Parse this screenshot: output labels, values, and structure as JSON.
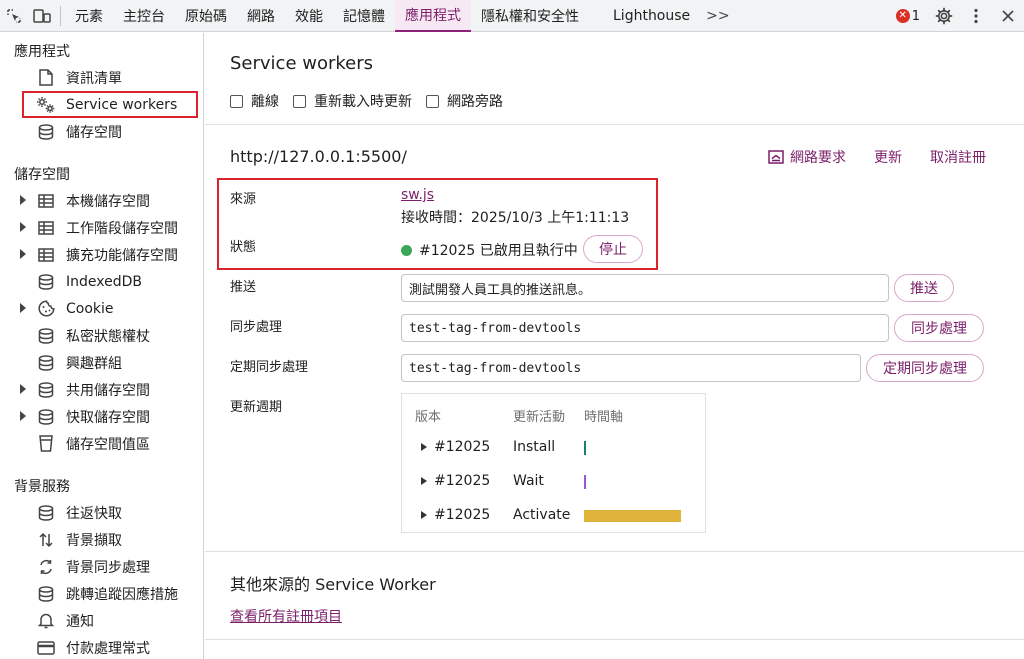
{
  "tabs": {
    "items": [
      "元素",
      "主控台",
      "原始碼",
      "網路",
      "效能",
      "記憶體",
      "應用程式",
      "隱私權和安全性",
      "Lighthouse"
    ],
    "more": ">>",
    "error_count": "1"
  },
  "sidebar": {
    "app_section": "應用程式",
    "app_items": [
      "資訊清單",
      "Service workers",
      "儲存空間"
    ],
    "storage_section": "儲存空間",
    "storage_items": [
      "本機儲存空間",
      "工作階段儲存空間",
      "擴充功能儲存空間",
      "IndexedDB",
      "Cookie",
      "私密狀態權杖",
      "興趣群組",
      "共用儲存空間",
      "快取儲存空間",
      "儲存空間值區"
    ],
    "bg_section": "背景服務",
    "bg_items": [
      "往返快取",
      "背景擷取",
      "背景同步處理",
      "跳轉追蹤因應措施",
      "通知",
      "付款處理常式"
    ]
  },
  "main": {
    "title": "Service workers",
    "options": [
      "離線",
      "重新載入時更新",
      "網路旁路"
    ],
    "origin": "http://127.0.0.1:5500/",
    "actions": {
      "network_requests": "網路要求",
      "update": "更新",
      "unregister": "取消註冊"
    },
    "source_label": "來源",
    "source_file": "sw.js",
    "received": "接收時間：2025/10/3 上午1:11:13",
    "status_label": "狀態",
    "status_text": "#12025 已啟用且執行中",
    "stop_label": "停止",
    "push_label": "推送",
    "push_value": "測試開發人員工具的推送訊息。",
    "push_button": "推送",
    "sync_label": "同步處理",
    "sync_value": "test-tag-from-devtools",
    "sync_button": "同步處理",
    "periodic_label": "定期同步處理",
    "periodic_value": "test-tag-from-devtools",
    "periodic_button": "定期同步處理",
    "cycle_label": "更新週期",
    "cycle": {
      "headers": [
        "版本",
        "更新活動",
        "時間軸"
      ],
      "rows": [
        {
          "version": "#12025",
          "activity": "Install",
          "color": "#1a7f74"
        },
        {
          "version": "#12025",
          "activity": "Wait",
          "color": "#9b59d0"
        },
        {
          "version": "#12025",
          "activity": "Activate",
          "color": "#e0b43a"
        }
      ]
    },
    "other_title": "其他來源的 Service Worker",
    "other_link": "查看所有註冊項目"
  },
  "colors": {
    "accent": "#8e2379",
    "highlight": "#d9232d",
    "status_green": "#3aa757"
  }
}
